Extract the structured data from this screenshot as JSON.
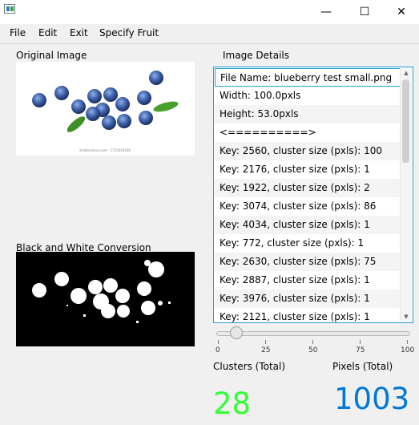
{
  "menu": [
    "File",
    "Edit",
    "Exit",
    "Specify Fruit"
  ],
  "window_controls": {
    "minimize": "—",
    "maximize": "☐",
    "close": "✕"
  },
  "left": {
    "original_label": "Original Image",
    "bw_label": "Black and White Conversion",
    "watermark": "shutterstock.com · 1755404180"
  },
  "right": {
    "details_label": "Image Details",
    "items": [
      "File Name: blueberry test small.png",
      "Width: 100.0pxls",
      "Height: 53.0pxls",
      "<==========>",
      "Key: 2560, cluster size (pxls): 100",
      "Key: 2176, cluster size (pxls): 1",
      "Key: 1922, cluster size (pxls): 2",
      "Key: 3074, cluster size (pxls): 86",
      "Key: 4034, cluster size (pxls): 1",
      "Key: 772, cluster size (pxls): 1",
      "Key: 2630, cluster size (pxls): 75",
      "Key: 2887, cluster size (pxls): 1",
      "Key: 3976, cluster size (pxls): 1",
      "Key: 2121, cluster size (pxls): 1"
    ]
  },
  "slider": {
    "value": 10,
    "ticks": [
      "0",
      "25",
      "50",
      "75",
      "100"
    ]
  },
  "stats": {
    "clusters_label": "Clusters (Total)",
    "pixels_label": "Pixels (Total)",
    "clusters_value": "28",
    "pixels_value": "1003"
  },
  "colors": {
    "clusters": "#33ff33",
    "pixels": "#0078d7",
    "accent": "#24a0d8"
  }
}
